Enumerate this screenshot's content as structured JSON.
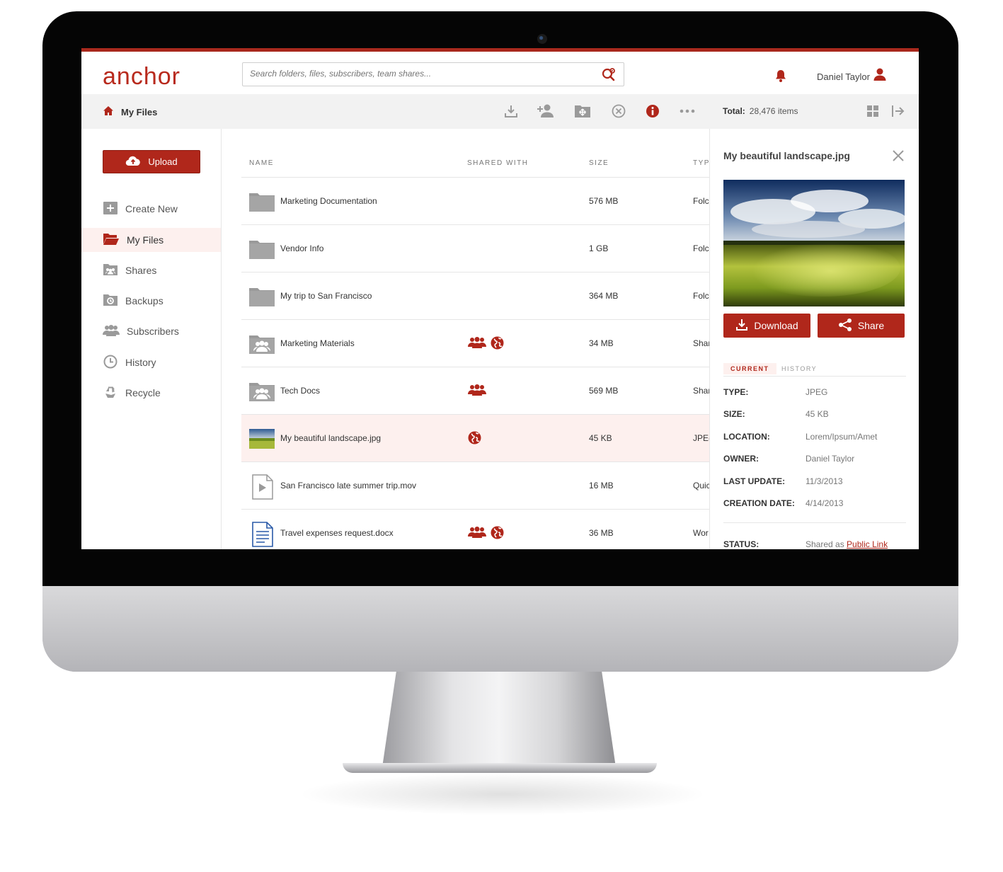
{
  "app": {
    "logo": "anchor",
    "accent": "#b0271b"
  },
  "search": {
    "placeholder": "Search folders, files, subscribers, team shares..."
  },
  "user": {
    "name": "Daniel Taylor"
  },
  "breadcrumb": {
    "label": "My Files"
  },
  "toolbar": {
    "icons": [
      "download-icon",
      "add-user-icon",
      "move-icon",
      "cancel-icon",
      "info-icon",
      "more-icon"
    ]
  },
  "summary": {
    "label": "Total:",
    "value": "28,476 items"
  },
  "sidebar": {
    "upload_label": "Upload",
    "items": [
      {
        "label": "Create New",
        "icon": "create-new-icon"
      },
      {
        "label": "My Files",
        "icon": "folder-open-icon",
        "active": true
      },
      {
        "label": "Shares",
        "icon": "shares-icon"
      },
      {
        "label": "Backups",
        "icon": "backups-icon"
      },
      {
        "label": "Subscribers",
        "icon": "subscribers-icon"
      },
      {
        "label": "History",
        "icon": "history-icon"
      },
      {
        "label": "Recycle",
        "icon": "recycle-icon"
      }
    ]
  },
  "table": {
    "columns": [
      "NAME",
      "SHARED WITH",
      "SIZE",
      "TYP"
    ],
    "rows": [
      {
        "name": "Marketing Documentation",
        "icon": "folder-icon",
        "shared": [],
        "size": "576 MB",
        "type": "Folc"
      },
      {
        "name": "Vendor Info",
        "icon": "folder-icon",
        "shared": [],
        "size": "1 GB",
        "type": "Folc"
      },
      {
        "name": "My trip to San Francisco",
        "icon": "folder-icon",
        "shared": [],
        "size": "364 MB",
        "type": "Folc"
      },
      {
        "name": "Marketing Materials",
        "icon": "shared-folder-icon",
        "shared": [
          "group-icon",
          "globe-icon"
        ],
        "size": "34 MB",
        "type": "Shar"
      },
      {
        "name": "Tech Docs",
        "icon": "shared-folder-icon",
        "shared": [
          "group-icon"
        ],
        "size": "569 MB",
        "type": "Shar"
      },
      {
        "name": "My beautiful landscape.jpg",
        "icon": "image-thumbnail",
        "shared": [
          "globe-icon"
        ],
        "size": "45 KB",
        "type": "JPE(",
        "selected": true
      },
      {
        "name": "San Francisco late summer trip.mov",
        "icon": "video-file-icon",
        "shared": [],
        "size": "16 MB",
        "type": "Quic"
      },
      {
        "name": "Travel expenses request.docx",
        "icon": "doc-file-icon",
        "shared": [
          "group-icon",
          "globe-icon"
        ],
        "size": "36 MB",
        "type": "Wor"
      }
    ]
  },
  "details": {
    "title": "My beautiful landscape.jpg",
    "download_label": "Download",
    "share_label": "Share",
    "tabs": [
      "CURRENT",
      "HISTORY"
    ],
    "fields": [
      {
        "key": "TYPE:",
        "value": "JPEG"
      },
      {
        "key": "SIZE:",
        "value": "45 KB"
      },
      {
        "key": "LOCATION:",
        "value": "Lorem/Ipsum/Amet"
      },
      {
        "key": "OWNER:",
        "value": "Daniel Taylor"
      },
      {
        "key": "LAST UPDATE:",
        "value": "11/3/2013"
      },
      {
        "key": "CREATION DATE:",
        "value": "4/14/2013"
      }
    ],
    "status": {
      "key": "STATUS:",
      "prefix": "Shared as",
      "link": "Public Link"
    }
  }
}
